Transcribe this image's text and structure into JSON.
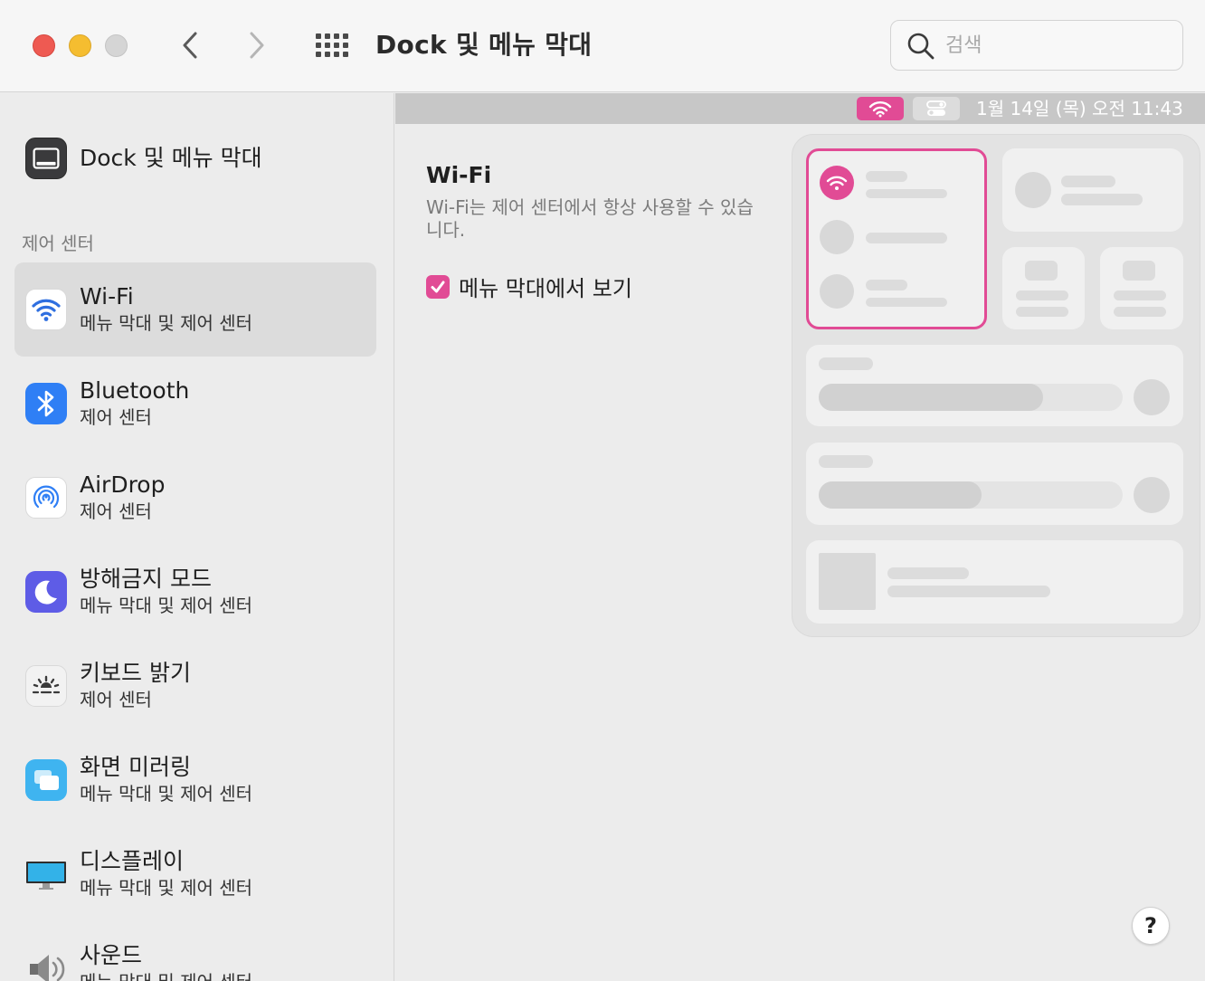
{
  "window": {
    "title": "Dock 및 메뉴 막대",
    "search_placeholder": "검색",
    "traffic_lights": {
      "close": "#ee5a52",
      "minimize": "#f5bd30",
      "zoom": "#d5d5d5"
    }
  },
  "sidebar": {
    "top_item": {
      "label": "Dock 및 메뉴 막대",
      "icon": "dock-icon"
    },
    "section_header": "제어 센터",
    "items": [
      {
        "title": "Wi-Fi",
        "subtitle": "메뉴 막대 및 제어 센터",
        "icon": "wifi-icon",
        "selected": true
      },
      {
        "title": "Bluetooth",
        "subtitle": "제어 센터",
        "icon": "bluetooth-icon",
        "selected": false
      },
      {
        "title": "AirDrop",
        "subtitle": "제어 센터",
        "icon": "airdrop-icon",
        "selected": false
      },
      {
        "title": "방해금지 모드",
        "subtitle": "메뉴 막대 및 제어 센터",
        "icon": "moon-icon",
        "selected": false
      },
      {
        "title": "키보드 밝기",
        "subtitle": "제어 센터",
        "icon": "keyboard-brightness-icon",
        "selected": false
      },
      {
        "title": "화면 미러링",
        "subtitle": "메뉴 막대 및 제어 센터",
        "icon": "screen-mirroring-icon",
        "selected": false
      },
      {
        "title": "디스플레이",
        "subtitle": "메뉴 막대 및 제어 센터",
        "icon": "display-icon",
        "selected": false
      },
      {
        "title": "사운드",
        "subtitle": "메뉴 막대 및 제어 센터",
        "icon": "speaker-icon",
        "selected": false
      }
    ]
  },
  "main": {
    "menubar_clock": "1월 14일 (목) 오전  11:43",
    "title": "Wi-Fi",
    "description": "Wi-Fi는 제어 센터에서 항상 사용할 수 있습니다.",
    "show_in_menubar": {
      "label": "메뉴 막대에서 보기",
      "checked": true
    },
    "help_label": "?"
  },
  "colors": {
    "accent": "#e14b95",
    "sidebar_selected": "#dcdcdc",
    "menubar_strip": "#c7c7c7"
  }
}
